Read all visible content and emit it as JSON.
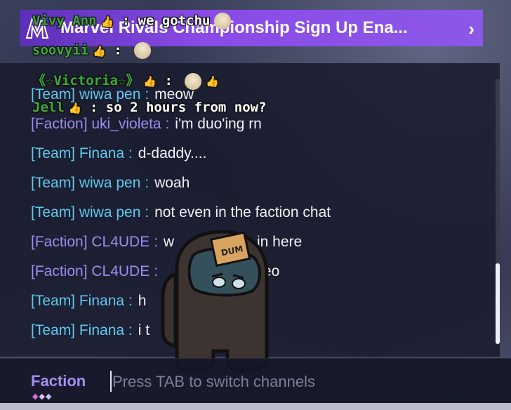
{
  "banner": {
    "title": "Marvel Rivals Championship Sign Up Ena...",
    "chevron": "›",
    "logo_icon": "marvel-rivals-logo"
  },
  "chat": {
    "messages": [
      {
        "channel": "[Team] wiwa pen",
        "text": "meow",
        "type": "team"
      },
      {
        "channel": "[Faction] uki_violeta",
        "text": "i'm duo'ing rn",
        "type": "faction"
      },
      {
        "channel": "[Team] Finana",
        "text": "d-daddy....",
        "type": "team"
      },
      {
        "channel": "[Team] wiwa pen",
        "text": "woah",
        "type": "team"
      },
      {
        "channel": "[Team] wiwa pen",
        "text": "not even in the faction chat",
        "type": "team"
      },
      {
        "channel": "[Faction] CL4UDE",
        "text": "w         ur duo in here",
        "type": "faction"
      },
      {
        "channel": "[Faction] CL4UDE",
        "text": "eo",
        "type": "faction"
      },
      {
        "channel": "[Team] Finana",
        "text": "h",
        "type": "team"
      },
      {
        "channel": "[Team] Finana",
        "text": "i t",
        "type": "team"
      }
    ]
  },
  "stream_chat": [
    {
      "user": "Vivy Ann",
      "text": "we gotchu"
    },
    {
      "user": "soovyii",
      "text": ""
    },
    {
      "user": "《☆Victoria☆》",
      "text": ""
    },
    {
      "user": "Jell",
      "text": "so 2 hours from now?"
    }
  ],
  "input": {
    "channel": "Faction",
    "placeholder": "Press TAB to switch channels",
    "diamonds": "◆◆◆"
  },
  "overlay": {
    "avatar_label": "DUM"
  },
  "colors": {
    "team": "#5ec9ee",
    "faction": "#9d8cf0",
    "banner": "#8a4be6",
    "stream_user": "#3ea83a"
  }
}
